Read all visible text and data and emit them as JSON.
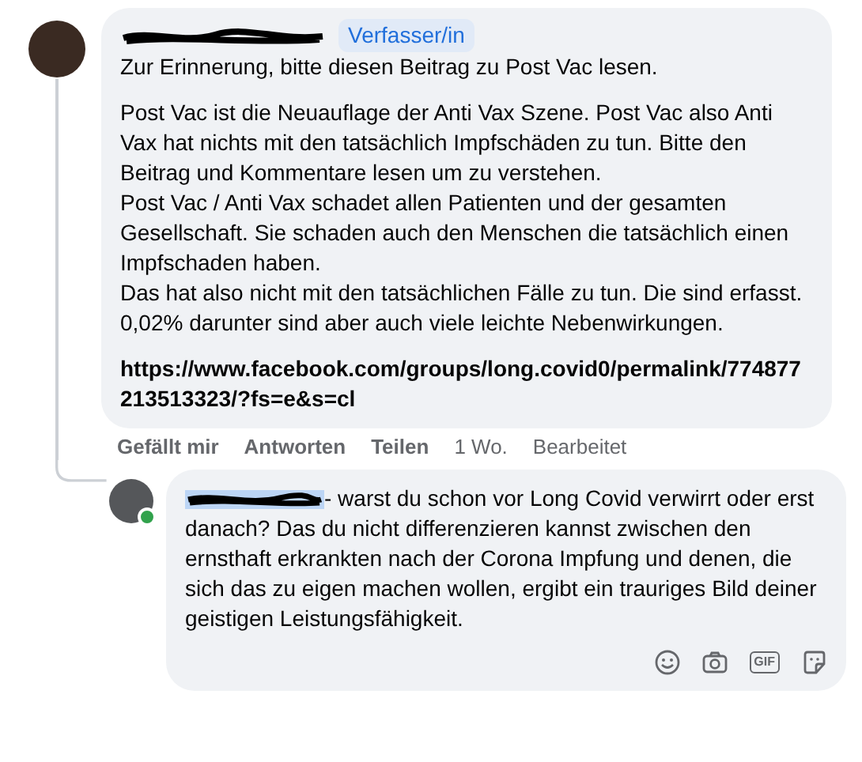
{
  "comment": {
    "author_redacted": true,
    "badge": "Verfasser/in",
    "intro": "Zur Erinnerung, bitte diesen Beitrag zu Post Vac lesen.",
    "body": [
      "Post Vac ist die Neuauflage der Anti Vax Szene. Post Vac also Anti Vax hat nichts mit den tatsächlich Impfschäden zu tun. Bitte den Beitrag und Kommentare lesen um zu verstehen.",
      "Post Vac / Anti Vax schadet allen Patienten und der gesamten Gesellschaft. Sie schaden auch den Menschen die tatsächlich einen Impfschaden haben.",
      "Das hat also nicht mit den tatsächlichen Fälle zu tun. Die sind erfasst. 0,02% darunter sind aber auch viele leichte Nebenwirkungen."
    ],
    "link": "https://www.facebook.com/groups/long.covid0/permalink/774877213513323/?fs=e&s=cl",
    "actions": [
      {
        "label": "Gefällt mir",
        "kind": "action"
      },
      {
        "label": "Antworten",
        "kind": "action"
      },
      {
        "label": "Teilen",
        "kind": "action"
      },
      {
        "label": "1 Wo.",
        "kind": "meta"
      },
      {
        "label": "Bearbeitet",
        "kind": "meta"
      }
    ]
  },
  "reply": {
    "online": true,
    "mention_selected": true,
    "text": "- warst du schon vor Long Covid verwirrt oder erst danach? Das du nicht differenzieren kannst zwischen den ernsthaft erkrankten nach der Corona Impfung und denen, die sich das zu eigen machen wollen, ergibt ein trauriges Bild deiner geistigen Leistungsfähigkeit.",
    "tools": [
      {
        "kind": "emoji"
      },
      {
        "kind": "camera"
      },
      {
        "kind": "gif",
        "label": "GIF"
      },
      {
        "kind": "sticker"
      }
    ]
  }
}
